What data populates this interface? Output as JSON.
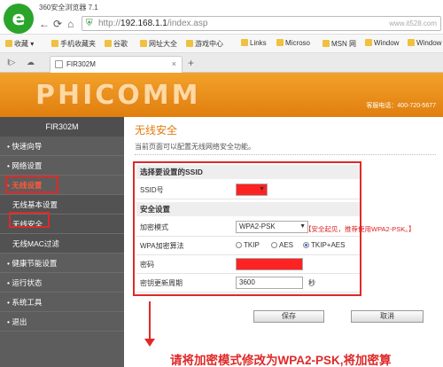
{
  "browser": {
    "title": "360安全浏览器 7.1",
    "url_prefix": "http://",
    "url_host": "192.168.1.1",
    "url_path": "/index.asp",
    "watermark": "www.it528.com",
    "favorites": [
      "收藏",
      "手机收藏夹",
      "谷歌",
      "网址大全",
      "游戏中心",
      "Links",
      "Microso",
      "MSN 网",
      "Window",
      "Window"
    ],
    "tab_title": "FIR302M"
  },
  "router": {
    "brand": "PHICOMM",
    "hotline": "客服电话：400-720-5677",
    "model": "FIR302M",
    "menu": [
      {
        "label": "快速向导"
      },
      {
        "label": "网络设置"
      },
      {
        "label": "无线设置"
      },
      {
        "label": "无线基本设置"
      },
      {
        "label": "无线安全"
      },
      {
        "label": "无线MAC过滤"
      },
      {
        "label": "健康节能设置"
      },
      {
        "label": "运行状态"
      },
      {
        "label": "系统工具"
      },
      {
        "label": "退出"
      }
    ]
  },
  "page": {
    "title": "无线安全",
    "description": "当前页面可以配置无线网络安全功能。",
    "section_ssid": "选择要设置的SSID",
    "ssid_label": "SSID号",
    "section_security": "安全设置",
    "mode_label": "加密模式",
    "mode_value": "WPA2-PSK",
    "mode_warning": "【安全起见，推荐使用WPA2-PSK。】",
    "algo_label": "WPA加密算法",
    "algo_options": [
      "TKIP",
      "AES",
      "TKIP+AES"
    ],
    "algo_selected": "TKIP+AES",
    "password_label": "密码",
    "renew_label": "密钥更新周期",
    "renew_value": "3600",
    "renew_unit": "秒",
    "save_label": "保存",
    "cancel_label": "取消"
  },
  "annotation": {
    "caption": "请将加密模式修改为WPA2-PSK,将加密算"
  },
  "colors": {
    "accent": "#e07e0e",
    "highlight": "#e02828",
    "sidebar": "#5d5d5d"
  }
}
